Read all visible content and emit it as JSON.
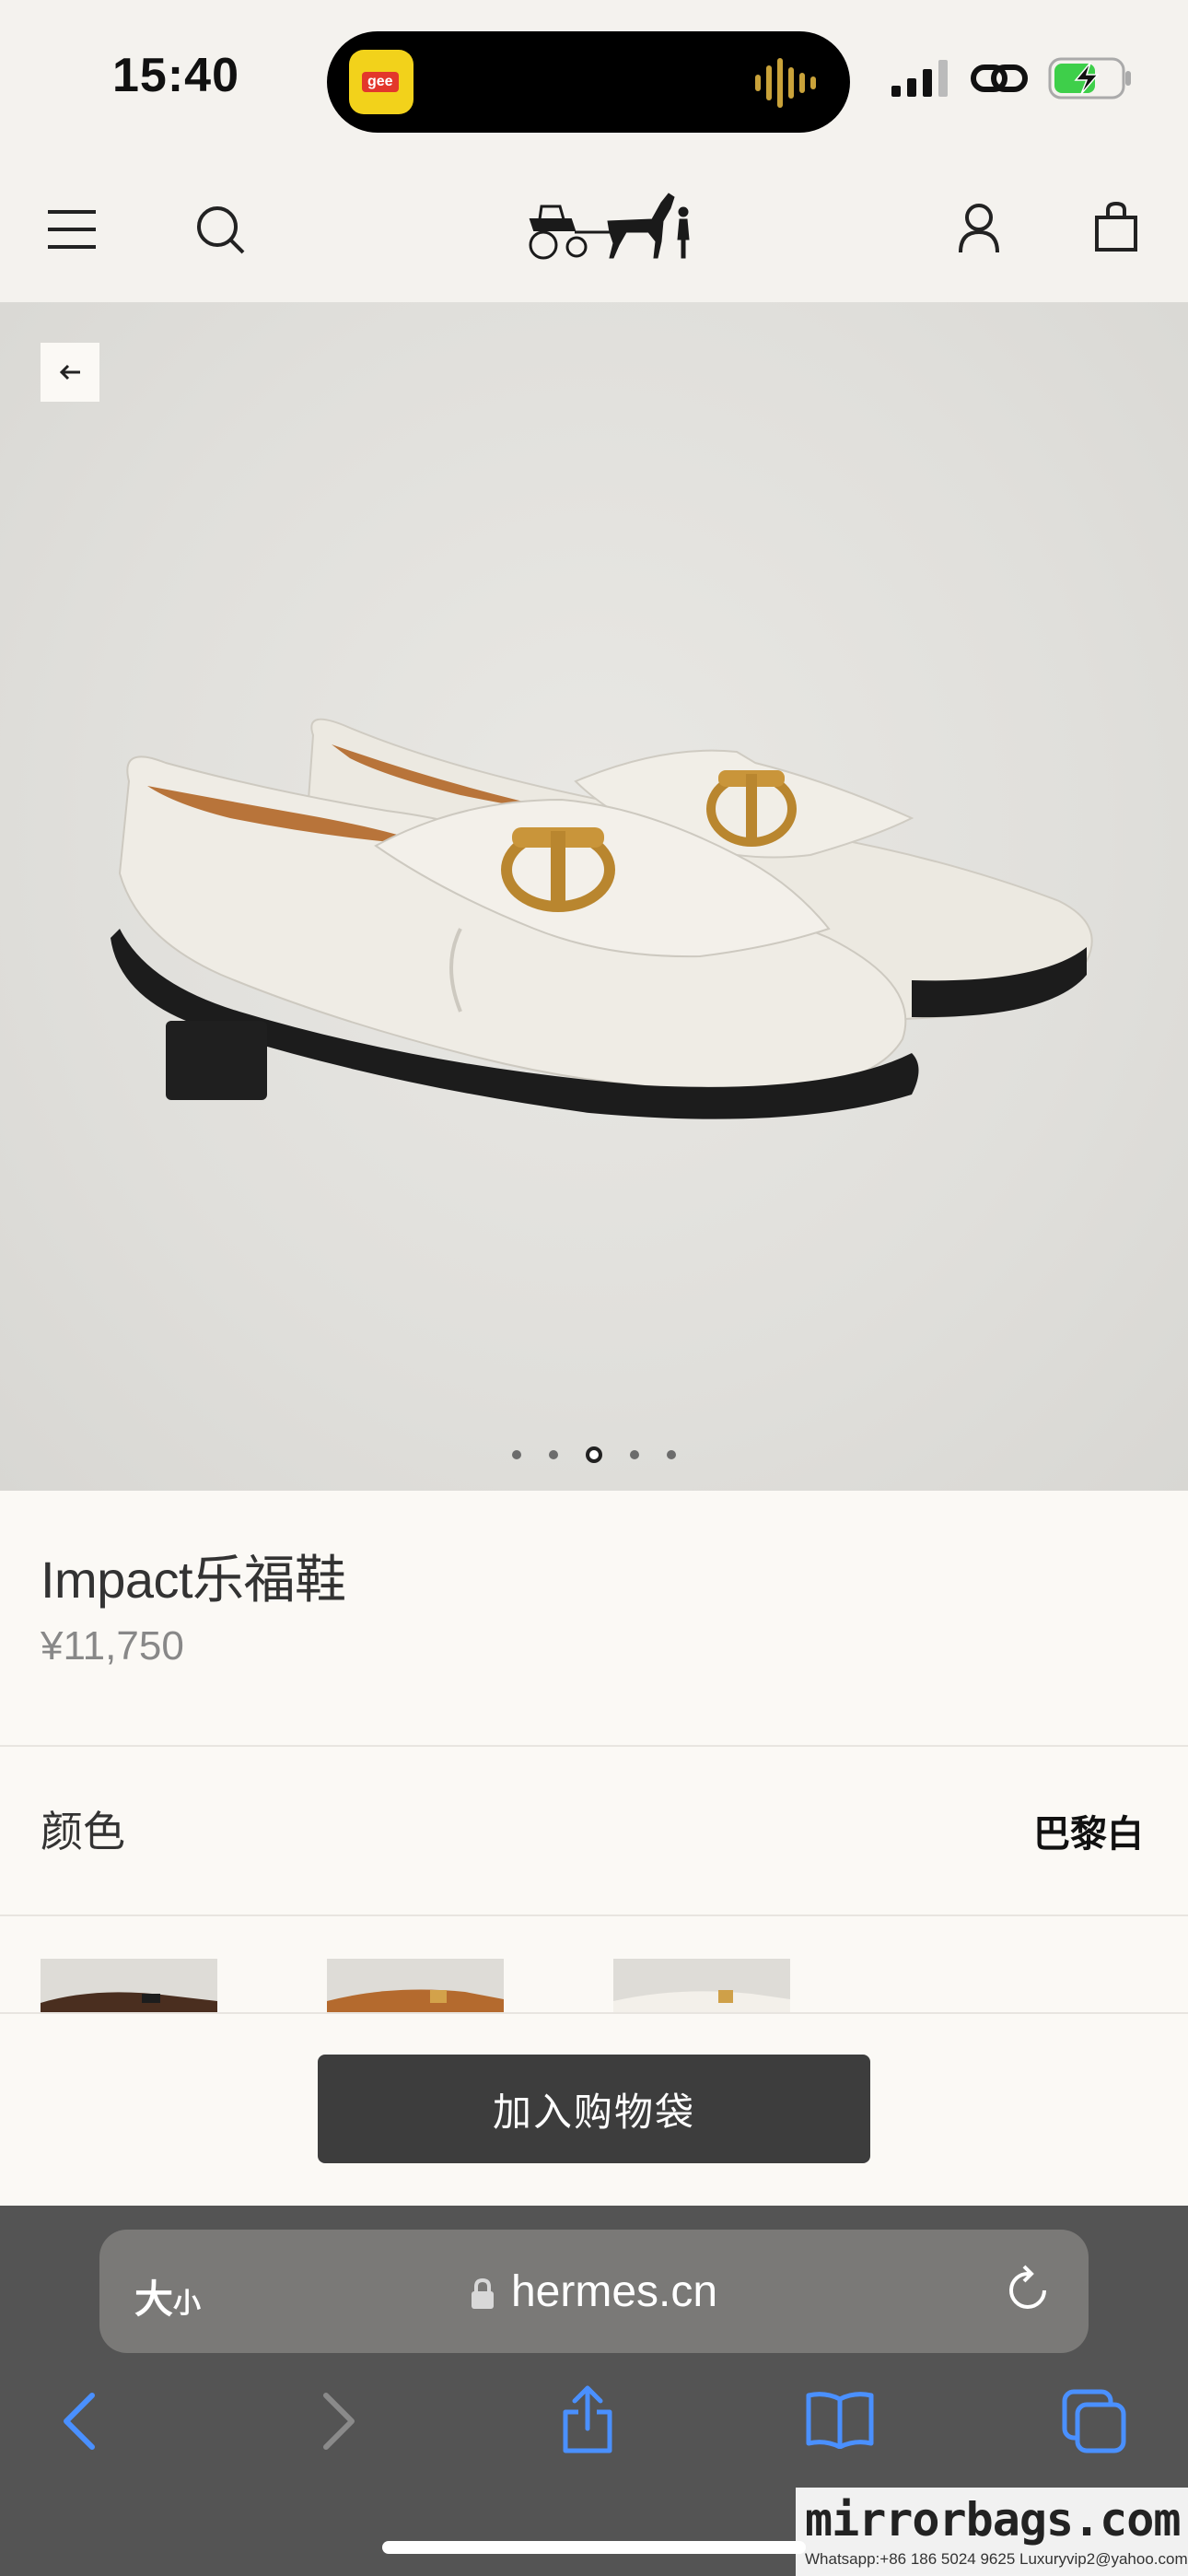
{
  "status_bar": {
    "time": "15:40",
    "island_app_tag": "gee",
    "icons": [
      "signal-icon",
      "link-icon",
      "battery-charging-icon"
    ]
  },
  "header": {
    "icons": [
      "menu-icon",
      "search-icon",
      "hermes-logo",
      "account-icon",
      "shopping-bag-icon"
    ]
  },
  "gallery": {
    "image_count": 5,
    "active_index": 3
  },
  "product": {
    "title": "Impact乐福鞋",
    "price": "¥11,750",
    "color_label": "颜色",
    "color_value": "巴黎白",
    "swatches": [
      "brown",
      "tan",
      "white"
    ]
  },
  "actions": {
    "add_to_cart": "加入购物袋"
  },
  "safari": {
    "text_size_big": "大",
    "text_size_small": "小",
    "url": "hermes.cn"
  },
  "watermark": {
    "main": "mirrorbags.com",
    "sub": "Whatsapp:+86 186 5024 9625   Luxuryvip2@yahoo.com"
  },
  "colors": {
    "header_bg": "#f4f2ee",
    "page_bg": "#fbf9f5",
    "button_bg": "#3d3d3d",
    "safari_bg": "#545454",
    "safari_accent": "#4a90ff",
    "battery_green": "#3ecf4a"
  }
}
